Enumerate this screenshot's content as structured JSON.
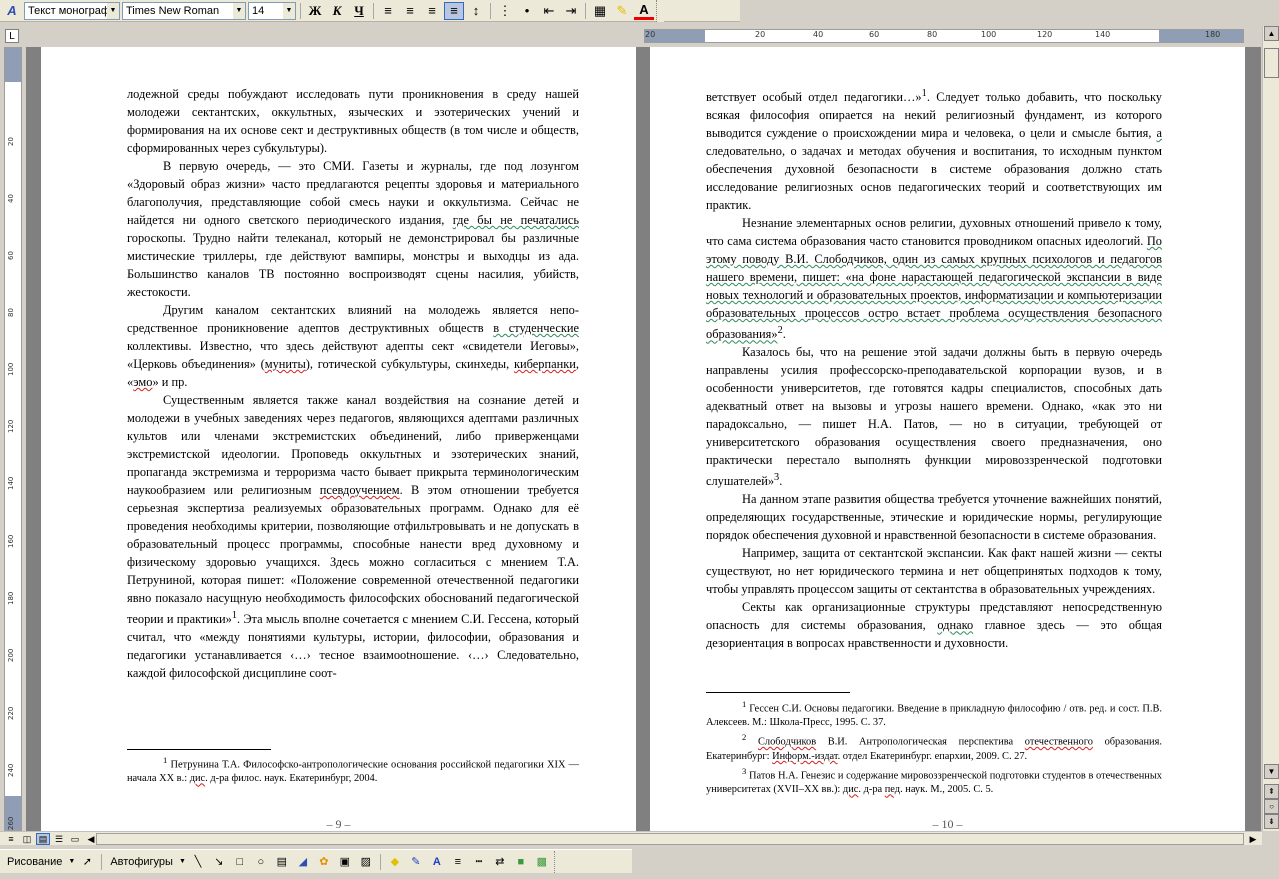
{
  "toolbar": {
    "style_value": "Текст монограф",
    "font_value": "Times New Roman",
    "size_value": "14",
    "bold": "Ж",
    "italic": "К",
    "underline": "Ч",
    "font_color_letter": "A"
  },
  "ruler": {
    "ticks": [
      "20",
      "20",
      "40",
      "60",
      "80",
      "100",
      "120",
      "140",
      "180"
    ],
    "vticks": [
      "20",
      "40",
      "60",
      "80",
      "100",
      "120",
      "140",
      "160",
      "180",
      "200",
      "220",
      "240",
      "260"
    ]
  },
  "left_page": {
    "p1": "лодежной среды побуждают исследовать пути проникновения в среду на­шей молодежи сектантских, оккультных, языческих и эзотерических уче­ний и формирования на их основе сект и деструктивных обществ (в том числе и обществ, сформированных через субкультуры).",
    "p2a": "В первую очередь, — это СМИ. Газеты и журналы, где под лозунгом «Здоровый образ жизни» часто предлагаются рецепты здоровья и матери­ального благополучия, представляющие собой смесь науки и оккультизма. Сейчас не найдется ни одного светского периодического издания, ",
    "p2sq": "где бы не печатались",
    "p2b": " гороскопы. Трудно найти телеканал, который не демонстри­ровал бы различные мистические триллеры, где действуют вампиры, мон­стры и выходцы из ада. Большинство каналов ТВ постоянно воспроизводят сцены насилия, убийств, жестокости.",
    "p3a": "Другим каналом сектантских влияний на молодежь является непо­средственное проникновение адептов деструктивных обществ ",
    "p3sq": "в студенче­ские",
    "p3b": " коллективы. Известно, что здесь действуют адепты сект «свидетели Иеговы», «Церковь объединения» (",
    "p3r1": "муниты",
    "p3c": "), готической субкультуры, скинхеды, ",
    "p3r2": "киберпанки",
    "p3d": ", «",
    "p3r3": "эмо",
    "p3e": "» и пр.",
    "p4a": "Существенным является также канал воздействия на сознание детей и молодежи в учебных заведениях через педагогов, являющихся адептами различных культов или членами экстремистских объединений, либо при­верженцами экстремистской идеологии. Проповедь оккультных и эзотери­ческих знаний, пропаганда экстремизма и терроризма часто бывает при­крыта терминологическим наукообразием или религиозным ",
    "p4r1": "псевдо­учением",
    "p4b": ". В этом отношении требуется серьезная экспертиза реализуемых образовательных программ. Однако для её проведения необходимы крите­рии, позволяющие отфильтровывать и не допускать в образовательный процесс программы, способные нанести вред духовному и физическому здоровью учащихся. Здесь можно согласиться с мнением Т.А. Петруниной, которая пишет: «Положение современной отечественной педагогики явно показало насущную необходимость философских обоснований педагоги­ческой теории и практики»",
    "p4sup": "1",
    "p4c": ". Эта мысль вполне сочетается с мнением С.И. Гессена, который считал, что «между понятиями культуры, истории, философии, образования и педагогики устанавливается ‹…› тесное взаи­мootношение. ‹…› Следовательно, каждой философской дисциплине соот-",
    "fn_sup": "1",
    "fn_a": " Петрунина Т.А. Философско-антропологические основания российской педа­гогики XIX — начала XX в.: ",
    "fn_r": "дис",
    "fn_b": ". д-ра филос. наук. Екатеринбург, 2004.",
    "page_num": "– 9 –"
  },
  "right_page": {
    "p1a": "ветствует особый отдел педагогики…»",
    "p1sup": "1",
    "p1b": ". Следует только добавить, что по­скольку всякая философия опирается на некий религиозный фундамент, из которого выводится суждение о происхождении мира и человека, о цели и смысле бытия, ",
    "p1sq": "а",
    "p1c": " следовательно, о задачах и методах обучения и воспита­ния, то исходным пунктом обеспечения духовной безопасности в системе образования должно стать исследование религиозных основ педагогиче­ских теорий и соответствующих им практик.",
    "p2a": "Незнание элементарных основ религии, духовных отношений привело к тому, что сама система образования часто становится проводником опас­ных идеологий. ",
    "p2sq": "По этому поводу В.И. Слободчиков, один из самых крупных психологов и педагогов нашего времени, пишет: «на фоне нарастающей пе­дагогической экспансии в виде новых технологий и образовательных проек­тов, информатизации и компьютеризации образовательных процессов остро встает проблема осуществления безопасного образования»",
    "p2sup": "2",
    "p2b": ".",
    "p3a": "Казалось бы, что на решение этой задачи должны быть в первую очередь направлены усилия профессорско-преподавательской корпорации вузов, и в особенности университетов, где готовятся кадры специалистов, способных дать адекватный ответ на вызовы и угрозы нашего времени. Однако, «как это ни парадоксально, — пишет Н.А. Патов, — но в ситуа­ции, требующей от университетского образования осуществления своего предназначения, оно практически перестало выполнять функции мировоз­зренческой подготовки слушателей»",
    "p3sup": "3",
    "p3b": ".",
    "p4": "На данном этапе развития общества требуется уточнение важнейших понятий, определяющих государственные, этические и юридические нор­мы, регулирующие порядок обеспечения духовной и нравственной безо­пасности в системе образования.",
    "p5": "Например, защита от сектантской экспансии. Как факт нашей жиз­ни — секты существуют, но нет юридического термина и нет общеприня­тых подходов к тому, чтобы управлять процессом защиты от сектантства в образовательных учреждениях.",
    "p6a": "Секты как организационные структуры представляют непосредст­венную опасность для системы образования, ",
    "p6sq": "однако",
    "p6b": " главное здесь — это общая дезориентация в вопросах нравственности и духовности.",
    "fn1_sup": "1",
    "fn1": " Гессен С.И. Основы педагогики. Введение в прикладную философию / отв. ред. и сост. П.В. Алексеев. М.: Школа-Пресс, 1995. С. 37.",
    "fn2_sup": "2",
    "fn2a": " ",
    "fn2r1": "Слободчиков",
    "fn2b": " В.И. Антропологическая перспектива ",
    "fn2r2": "отечественного",
    "fn2c": " образова­ния. Екатеринбург: ",
    "fn2r3": "Информ.-издат",
    "fn2d": ". отдел Екатеринбург. епархии, 2009. С. 27.",
    "fn3_sup": "3",
    "fn3a": " Патов Н.А. Генезис и содержание мировоззренческой подготовки студентов в отечественных университетах (XVII–XX вв.): ",
    "fn3r1": "дис",
    "fn3b": ". д-ра ",
    "fn3r2": "пед",
    "fn3c": ". наук. М., 2005. С. 5.",
    "page_num": "– 10 –"
  },
  "drawbar": {
    "drawing_label": "Рисование",
    "autoshapes_label": "Автофигуры"
  }
}
